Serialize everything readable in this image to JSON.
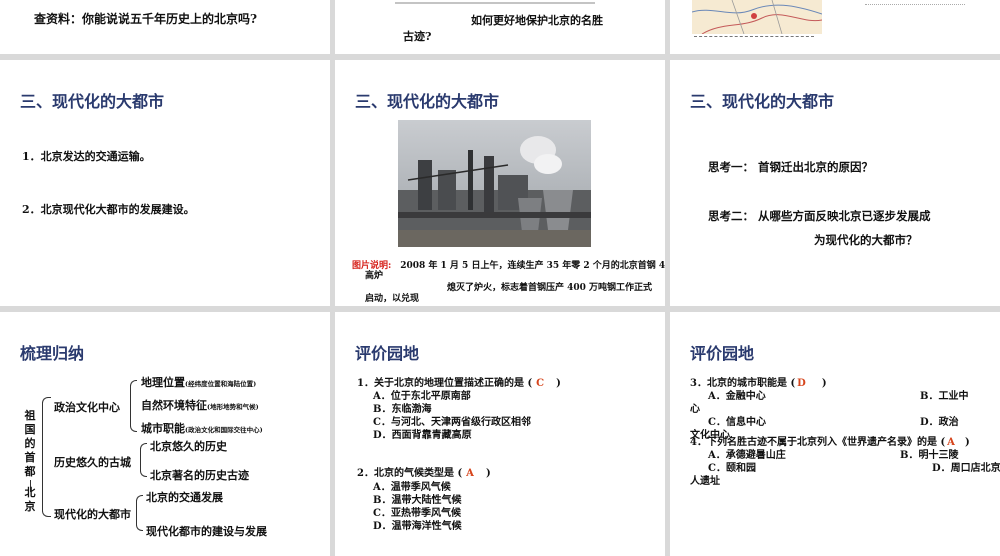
{
  "s1": {
    "text": "查资料：你能说说五千年历史上的北京吗?"
  },
  "s2": {
    "line1": "如何更好地保护北京的名胜",
    "line2": "古迹?"
  },
  "s4": {
    "title": "三、现代化的大都市",
    "item1": "1．北京发达的交通运输。",
    "item2": "2．北京现代化大都市的发展建设。"
  },
  "s5": {
    "title": "三、现代化的大都市",
    "caption_label": "图片说明:",
    "caption_line1": "2008 年 1 月 5 日上午，连续生产 35 年零 2 个月的北京首钢 4 号",
    "caption_line2": "高炉",
    "caption_line3": "熄灭了炉火，标志着首钢压产 400 万吨钢工作正式",
    "caption_line4": "启动，以兑现"
  },
  "s6": {
    "title": "三、现代化的大都市",
    "q1": "思考一：  首钢迁出北京的原因？",
    "q2a": "思考二：  从哪些方面反映北京已逐步发展成",
    "q2b": "为现代化的大都市？"
  },
  "s7": {
    "title": "梳理归纳",
    "root": [
      "祖",
      "国",
      "的",
      "首",
      "都",
      "—",
      "—",
      "北",
      "京"
    ],
    "branch1": "政治文化中心",
    "b1_items": [
      {
        "main": "地理位置",
        "note": "(经纬度位置和海陆位置)"
      },
      {
        "main": "自然环境特征",
        "note": "(地形地势和气候)"
      },
      {
        "main": "城市职能",
        "note": "(政治文化和国际交往中心)"
      }
    ],
    "branch2": "历史悠久的古城",
    "b2_items": [
      "北京悠久的历史",
      "北京著名的历史古迹"
    ],
    "branch3": "现代化的大都市",
    "b3_items": [
      "北京的交通发展",
      "现代化都市的建设与发展"
    ]
  },
  "s8": {
    "title": "评价园地",
    "q1_pre": "1．关于北京的地理位置描述正确的是 (",
    "q1_ans": "C",
    "q1_post": ")",
    "q1_opts": [
      "A．位于东北平原南部",
      "B．东临渤海",
      "C．与河北、天津两省级行政区相邻",
      "D．西面背靠青藏高原"
    ],
    "q2_pre": "2．北京的气候类型是 (",
    "q2_ans": "A",
    "q2_post": ")",
    "q2_opts": [
      "A．温带季风气候",
      "B．温带大陆性气候",
      "C．亚热带季风气候",
      "D．温带海洋性气候"
    ]
  },
  "s9": {
    "title": "评价园地",
    "q3_pre": "3．北京的城市职能是 (",
    "q3_ans": "D",
    "q3_post": ")",
    "q3_a": "A．金融中心",
    "q3_b": "B．工业中",
    "q3_b2": "心",
    "q3_c": "C．信息中心",
    "q3_d": "D．政治",
    "q3_d2": "文化中心",
    "q4_pre": "4．下列名胜古迹不属于北京列入《世界遗产名录》的是 (",
    "q4_ans": "A",
    "q4_post": ")",
    "q4_a": "A．承德避暑山庄",
    "q4_b": "B．明十三陵",
    "q4_c": "C．颐和园",
    "q4_d": "D．周口店北京",
    "q4_d2": "人遗址"
  }
}
